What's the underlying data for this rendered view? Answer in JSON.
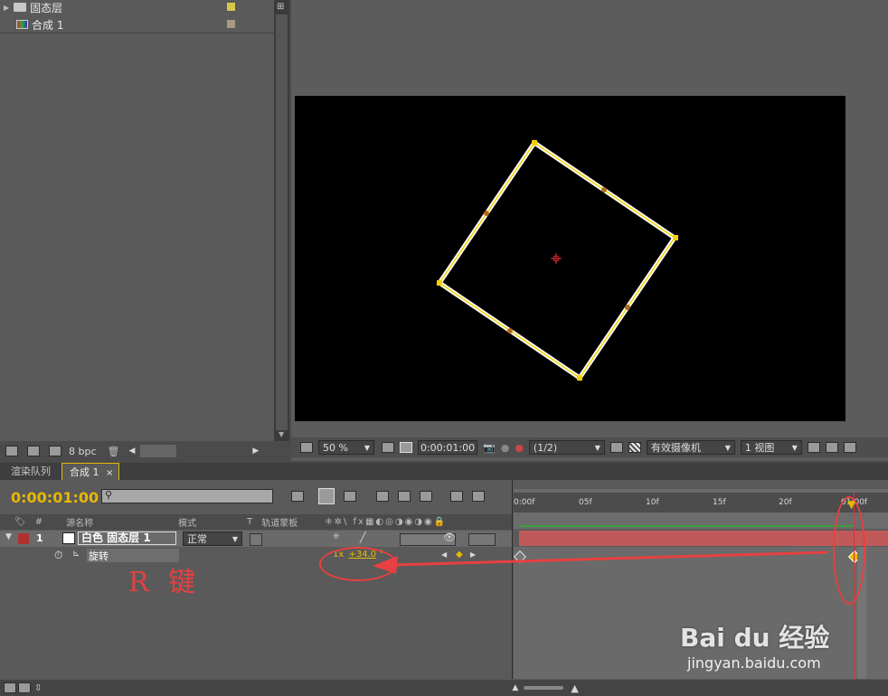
{
  "project": {
    "items": [
      {
        "label": "固态层",
        "type": "folder",
        "color": "#d9c74a"
      },
      {
        "label": "合成 1",
        "type": "composition",
        "color": "#a89a7e"
      }
    ],
    "bottom_bar": {
      "bpc": "8 bpc"
    }
  },
  "viewer": {
    "zoom": "50 %",
    "timecode": "0:00:01:00",
    "resolution": "(1/2)",
    "camera": "有效摄像机",
    "views": "1 视图"
  },
  "tabs": [
    {
      "label": "渲染队列",
      "active": false
    },
    {
      "label": "合成 1",
      "active": true,
      "close": "×"
    }
  ],
  "timeline": {
    "current_time": "0:00:01:00",
    "search_placeholder": "",
    "columns": {
      "index": "#",
      "source_name": "源名称",
      "mode": "模式",
      "t": "T",
      "track_matte": "轨道蒙板"
    },
    "layer": {
      "number": "1",
      "name": "白色 固态层 1",
      "mode": "正常",
      "label_color": "#b03030"
    },
    "property": {
      "name": "旋转",
      "value_rev": "1x",
      "value_deg": "+34.0",
      "unit": "°"
    },
    "ruler": [
      "0:00f",
      "05f",
      "10f",
      "15f",
      "20f",
      "01:00f"
    ],
    "annotation": "R 键"
  },
  "watermark": {
    "brand": "Bai du 经验",
    "url": "jingyan.baidu.com"
  },
  "colors": {
    "accent": "#e8b800",
    "playhead": "#e03030",
    "annotation": "#e84040",
    "layer_bar": "#c05a5a"
  }
}
